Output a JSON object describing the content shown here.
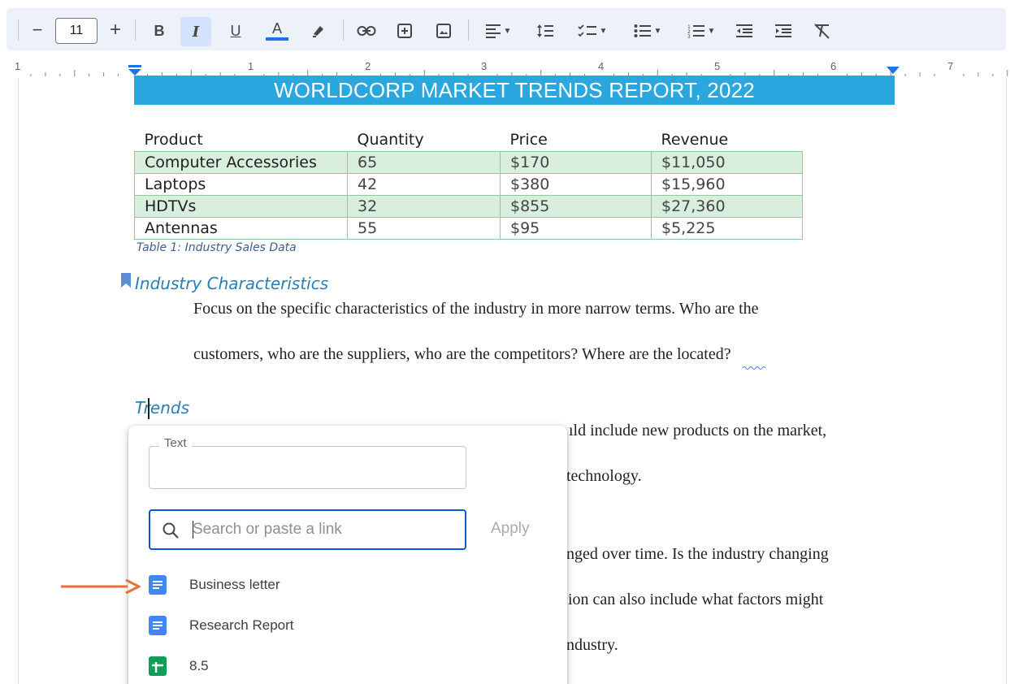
{
  "toolbar": {
    "font_size": "11",
    "decrease_label": "−",
    "increase_label": "+",
    "bold_label": "B",
    "italic_label": "I",
    "underline_label": "U",
    "text_color_label": "A",
    "text_color": "#1a73e8",
    "icons": [
      "minus-icon",
      "plus-icon",
      "bold-icon",
      "italic-icon",
      "underline-icon",
      "text-color-icon",
      "highlight-icon",
      "link-icon",
      "add-comment-icon",
      "insert-image-icon",
      "align-icon",
      "line-spacing-icon",
      "checklist-icon",
      "bullet-list-icon",
      "numbered-list-icon",
      "decrease-indent-icon",
      "increase-indent-icon",
      "clear-formatting-icon"
    ]
  },
  "ruler": {
    "numbers": [
      "1",
      "1",
      "2",
      "3",
      "4",
      "5",
      "6",
      "7"
    ]
  },
  "document": {
    "banner_title": "WORLDCORP MARKET TRENDS REPORT, 2022",
    "table": {
      "headers": [
        "Product",
        "Quantity",
        "Price",
        "Revenue"
      ],
      "rows": [
        [
          "Computer Accessories",
          "65",
          "$170",
          "$11,050"
        ],
        [
          "Laptops",
          "42",
          "$380",
          "$15,960"
        ],
        [
          "HDTVs",
          "32",
          "$855",
          "$27,360"
        ],
        [
          "Antennas",
          "55",
          "$95",
          "$5,225"
        ]
      ]
    },
    "caption": "Table 1: Industry Sales Data",
    "heading1": "Industry Characteristics",
    "para1_line1": "Focus on the specific characteristics of the industry in more narrow terms.  Who are the",
    "para1_line2": "customers, who are the suppliers, who are the competitors? Where are the located?",
    "heading2": "Trends",
    "para2_line1": "ıld include new products on the market,",
    "para2_line2": "technology.",
    "para3_line1": "nged over time.  Is the industry changing",
    "para3_line2": "ion can also include what factors might",
    "para3_line3": "ndustry."
  },
  "link_popup": {
    "text_label": "Text",
    "text_value": "",
    "search_placeholder": "Search or paste a link",
    "apply_label": "Apply",
    "results": [
      {
        "label": "Business letter",
        "icon": "google-docs-icon",
        "color": "#4285f4"
      },
      {
        "label": "Research Report",
        "icon": "google-docs-icon",
        "color": "#4285f4"
      },
      {
        "label": "8.5",
        "icon": "google-sheets-icon",
        "color": "#0f9d58"
      }
    ]
  },
  "colors": {
    "banner": "#2aa7df",
    "table_shade": "#d9eedd",
    "heading": "#2a7fb8",
    "arrow": "#e8703a",
    "focus": "#0b57d0"
  }
}
